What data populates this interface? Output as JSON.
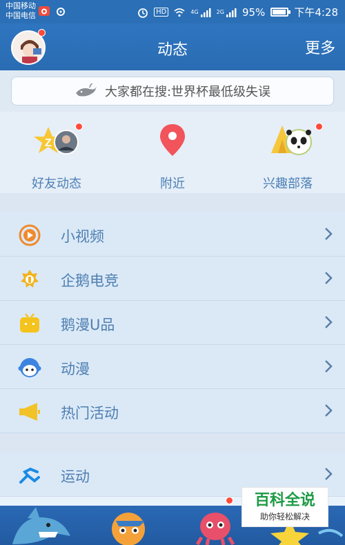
{
  "status": {
    "carrier1": "中国移动",
    "carrier2": "中国电信",
    "network_a": "4G",
    "network_b": "2G",
    "hd": "HD",
    "battery": "95%",
    "time": "下午4:28"
  },
  "header": {
    "title": "动态",
    "more": "更多"
  },
  "search": {
    "text": "大家都在搜:世界杯最低级失误"
  },
  "quick": [
    {
      "label": "好友动态",
      "icon": "friends-feed-icon"
    },
    {
      "label": "附近",
      "icon": "location-pin-icon"
    },
    {
      "label": "兴趣部落",
      "icon": "interest-tribe-icon"
    }
  ],
  "menu1": [
    {
      "label": "小视频",
      "icon": "video-icon",
      "color": "#f08a2c"
    },
    {
      "label": "企鹅电竞",
      "icon": "esports-icon",
      "color": "#f2b31d"
    },
    {
      "label": "鹅漫U品",
      "icon": "tv-icon",
      "color": "#f5c31e"
    },
    {
      "label": "动漫",
      "icon": "anime-icon",
      "color": "#3d84e0"
    },
    {
      "label": "热门活动",
      "icon": "megaphone-icon",
      "color": "#f2c229"
    }
  ],
  "menu2": [
    {
      "label": "运动",
      "icon": "running-icon",
      "color": "#1a8be3"
    }
  ],
  "watermark": {
    "title": "百科全说",
    "subtitle": "助你轻松解决"
  },
  "colors": {
    "header": "#2e75c0",
    "badge": "#ff4a3a",
    "label": "#4f7fb0"
  }
}
